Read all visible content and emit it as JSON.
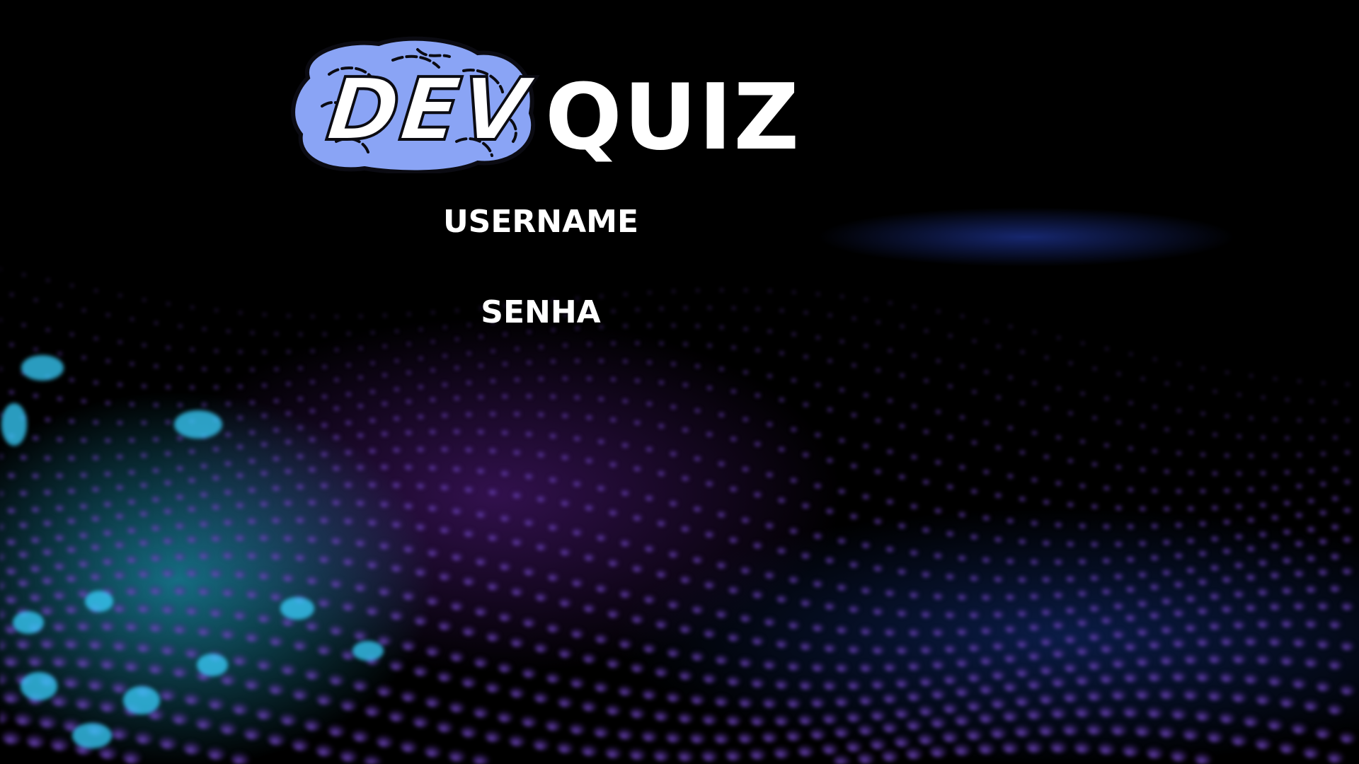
{
  "logo": {
    "dev_text": "DEV",
    "quiz_text": "QUIZ",
    "brain_color": "#8aa4f5"
  },
  "form": {
    "username_label": "USERNAME",
    "username_value": "",
    "password_label": "SENHA",
    "password_value": ""
  },
  "colors": {
    "background": "#000000",
    "text": "#ffffff",
    "glow_cyan": "#28c8f0",
    "glow_purple": "#5a1e8c",
    "glow_blue": "#2846c8"
  }
}
